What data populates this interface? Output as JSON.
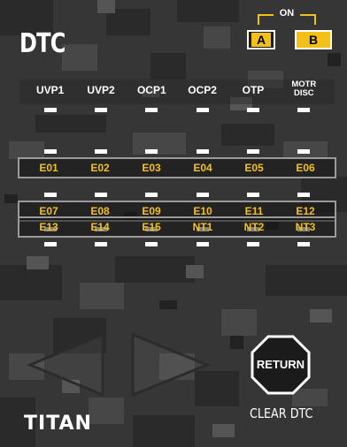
{
  "header": {
    "title": "DTC",
    "on_label": "ON",
    "mode_a": "A",
    "mode_b": "B",
    "active_mode": "B"
  },
  "status_indicators": [
    {
      "label": "UVP1"
    },
    {
      "label": "UVP2"
    },
    {
      "label": "OCP1"
    },
    {
      "label": "OCP2"
    },
    {
      "label": "OTP"
    },
    {
      "label": "MOTR DISC",
      "line1": "MOTR",
      "line2": "DISC"
    }
  ],
  "error_rows": [
    [
      "E01",
      "E02",
      "E03",
      "E04",
      "E05",
      "E06"
    ],
    [
      "E07",
      "E08",
      "E09",
      "E10",
      "E11",
      "E12"
    ],
    [
      "E13",
      "E14",
      "E15",
      "NT1",
      "NT2",
      "NT3"
    ]
  ],
  "controls": {
    "return_label": "RETURN",
    "clear_label": "CLEAR DTC"
  },
  "brand": "TITAN",
  "colors": {
    "accent": "#f3c019",
    "text": "#ffffff",
    "frame": "#9a9a9a"
  },
  "icons": [
    "left-arrow-icon",
    "right-arrow-icon",
    "stop-octagon-icon"
  ]
}
